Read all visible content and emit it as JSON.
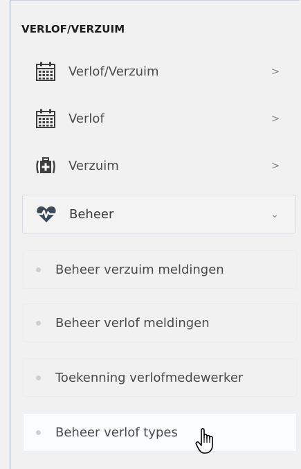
{
  "section_title": "VERLOF/VERZUIM",
  "menu": [
    {
      "label": "Verlof/Verzuim",
      "icon": "calendar-icon",
      "chevron": ">"
    },
    {
      "label": "Verlof",
      "icon": "calendar-icon",
      "chevron": ">"
    },
    {
      "label": "Verzuim",
      "icon": "medical-kit-icon",
      "chevron": ">"
    },
    {
      "label": "Beheer",
      "icon": "heartbeat-icon",
      "chevron": "⌄"
    }
  ],
  "submenu": [
    {
      "label": "Beheer verzuim meldingen"
    },
    {
      "label": "Beheer verlof meldingen"
    },
    {
      "label": "Toekenning verlofmedewerker"
    },
    {
      "label": "Beheer verlof types"
    }
  ],
  "colors": {
    "icon": "#3f3f3f",
    "heart_icon": "#3d4c5c",
    "text": "#4a4a4a"
  }
}
